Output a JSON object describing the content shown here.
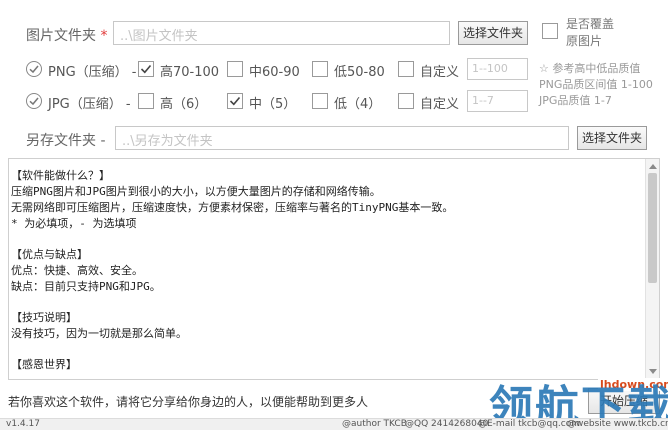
{
  "image_folder": {
    "label": "图片文件夹",
    "required_mark": "*",
    "placeholder": "..\\图片文件夹",
    "browse_label": "选择文件夹",
    "overwrite_line1": "是否覆盖",
    "overwrite_line2": "原图片"
  },
  "png": {
    "label": "PNG（压缩）",
    "dash": "-",
    "options": [
      "高70-100",
      "中60-90",
      "低50-80",
      "自定义"
    ],
    "checked": [
      true,
      false,
      false,
      false
    ],
    "custom_placeholder": "1--100"
  },
  "jpg": {
    "label": "JPG（压缩）",
    "dash": "-",
    "options": [
      "高（6）",
      "中（5）",
      "低（4）",
      "自定义"
    ],
    "checked": [
      false,
      true,
      false,
      false
    ],
    "custom_placeholder": "1--7"
  },
  "quality_hint": {
    "line1": "☆ 参考高中低品质值",
    "line2": "PNG品质区间值 1-100",
    "line3": "JPG品质值 1-7"
  },
  "save_folder": {
    "label": "另存文件夹",
    "dash": "-",
    "placeholder": "..\\另存为文件夹",
    "browse_label": "选择文件夹"
  },
  "description": {
    "lines": [
      "【软件能做什么？】",
      "压缩PNG图片和JPG图片到很小的大小，以方便大量图片的存储和网络传输。",
      "无需网络即可压缩图片，压缩速度快，方便素材保密，压缩率与著名的TinyPNG基本一致。",
      "* 为必填项，- 为选填项",
      "",
      "【优点与缺点】",
      "优点：快捷、高效、安全。",
      "缺点：目前只支持PNG和JPG。",
      "",
      "【技巧说明】",
      "没有技巧，因为一切就是那么简单。",
      "",
      "【感恩世界】"
    ]
  },
  "footer": {
    "share_text": "若你喜欢这个软件，请将它分享给你身边的人，以便能帮助到更多人",
    "start_button": "开始压缩"
  },
  "statusbar": {
    "version": "v1.4.17",
    "author": "@author TKCB",
    "qq": "@QQ 2414268040",
    "email": "@E-mail tkcb@qq.com",
    "website": "@website www.tkcb.cn"
  },
  "watermark": {
    "text": "领航下载",
    "url": "lhdown.com"
  }
}
